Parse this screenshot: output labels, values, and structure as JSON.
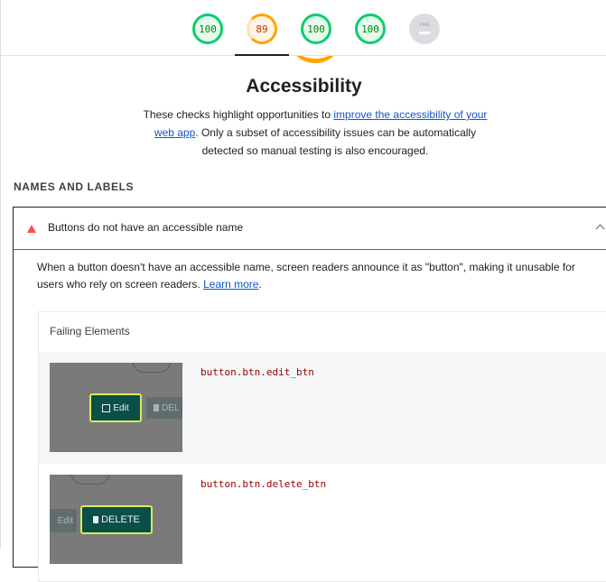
{
  "scores": [
    {
      "value": "100",
      "status": "pass"
    },
    {
      "value": "89",
      "status": "average",
      "active": true
    },
    {
      "value": "100",
      "status": "pass"
    },
    {
      "value": "100",
      "status": "pass"
    },
    {
      "label": "PWA",
      "status": "na"
    }
  ],
  "category": {
    "title": "Accessibility",
    "desc_before": "These checks highlight opportunities to ",
    "desc_link": "improve the accessibility of your web app",
    "desc_after": ". Only a subset of accessibility issues can be automatically detected so manual testing is also encouraged."
  },
  "group": {
    "title": "NAMES AND LABELS"
  },
  "audit": {
    "title": "Buttons do not have an accessible name",
    "desc_text": "When a button doesn't have an accessible name, screen readers announce it as \"button\", making it unusable for users who rely on screen readers. ",
    "learn_more": "Learn more",
    "desc_end": ".",
    "details_heading": "Failing Elements",
    "items": [
      {
        "selector": "button.btn.edit_btn",
        "thumb_primary": "Edit",
        "thumb_secondary": "DEL"
      },
      {
        "selector": "button.btn.delete_btn",
        "thumb_primary": "DELETE",
        "thumb_secondary": "Edit"
      }
    ]
  },
  "colors": {
    "pass": "#0cce6b",
    "average": "#ffa400",
    "fail": "#ff4e42",
    "link": "#1155cc",
    "selector": "#980000"
  }
}
